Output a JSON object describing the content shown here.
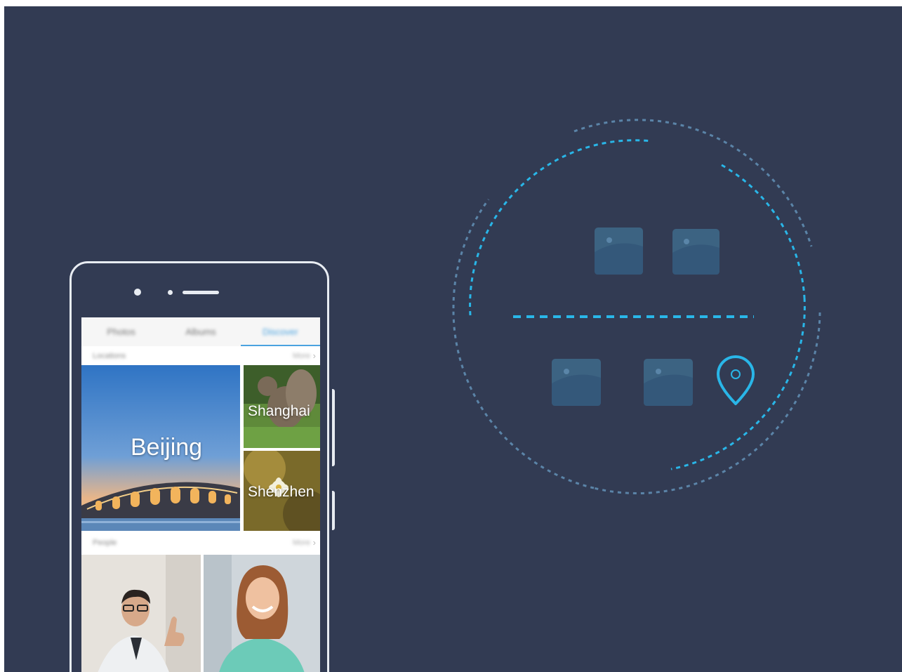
{
  "gallery": {
    "tabs": [
      {
        "label": "Photos",
        "active": false
      },
      {
        "label": "Albums",
        "active": false
      },
      {
        "label": "Discover",
        "active": true
      }
    ],
    "locations_section": {
      "title": "Locations",
      "more": "More",
      "tiles": [
        {
          "label": "Beijing"
        },
        {
          "label": "Shanghai"
        },
        {
          "label": "Shenzhen"
        }
      ]
    },
    "people_section": {
      "title": "People",
      "more": "More"
    }
  },
  "illustration": {
    "icons": [
      "photo-icon",
      "photo-icon",
      "photo-icon",
      "photo-icon",
      "location-pin-icon"
    ],
    "accent_color": "#29b6e8",
    "dim_color": "#5b84a8"
  },
  "colors": {
    "background": "#323b53",
    "phone_outline": "#e8ecf2",
    "photo_icon": "#3c6382"
  }
}
